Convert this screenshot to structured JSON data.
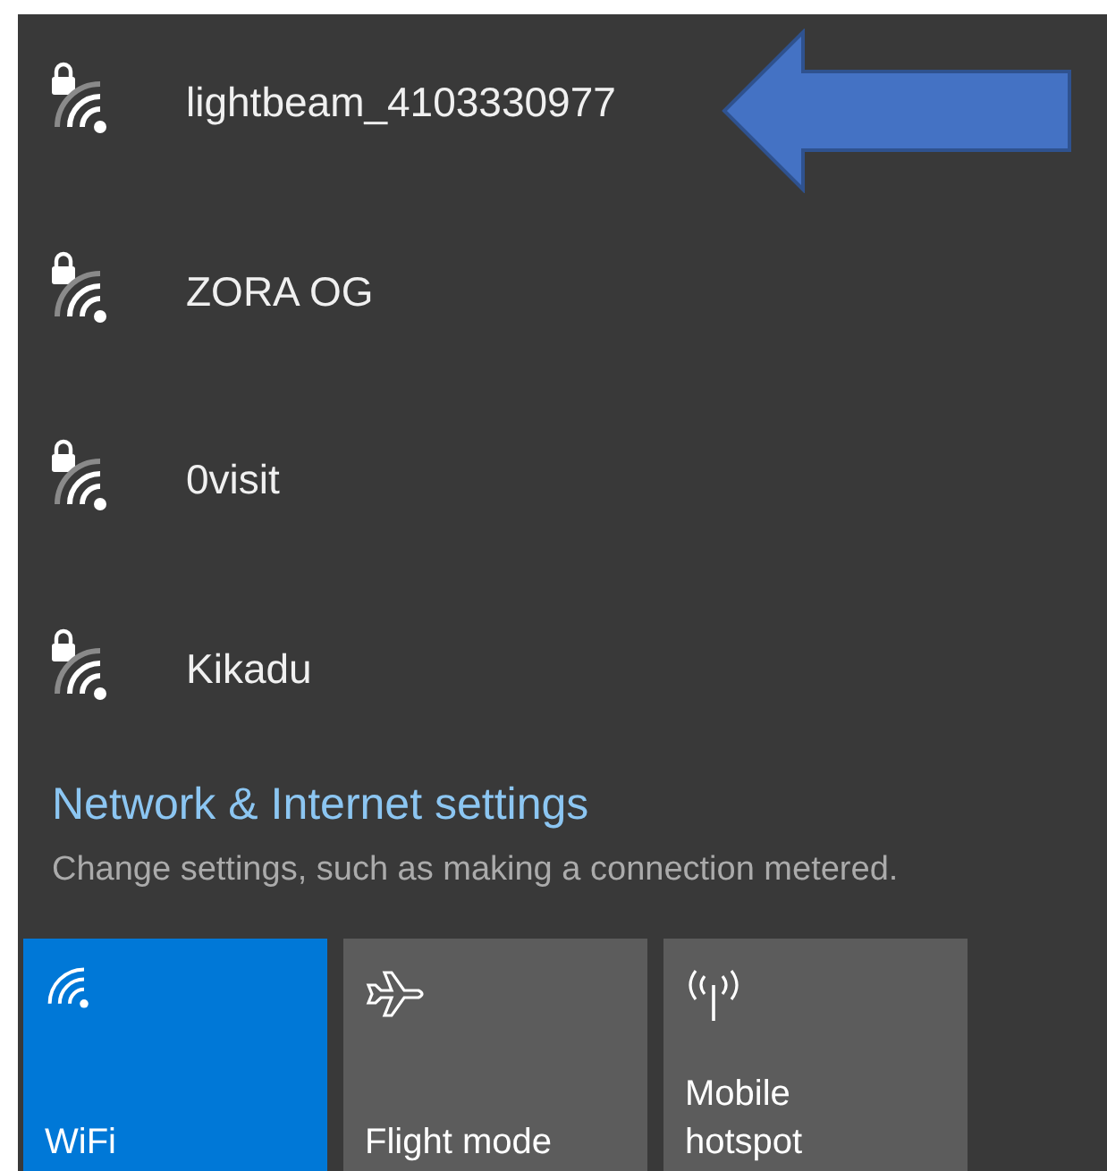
{
  "networks": [
    {
      "name": "lightbeam_4103330977",
      "secured": true
    },
    {
      "name": "ZORA OG",
      "secured": true
    },
    {
      "name": "0visit",
      "secured": true
    },
    {
      "name": "Kikadu",
      "secured": true
    }
  ],
  "settings_link": "Network & Internet settings",
  "settings_hint": "Change settings, such as making a connection metered.",
  "tiles": [
    {
      "kind": "wifi",
      "label": "WiFi",
      "on": true
    },
    {
      "kind": "flight",
      "label": "Flight mode",
      "on": false
    },
    {
      "kind": "hotspot",
      "label": "Mobile hotspot",
      "on": false
    }
  ]
}
